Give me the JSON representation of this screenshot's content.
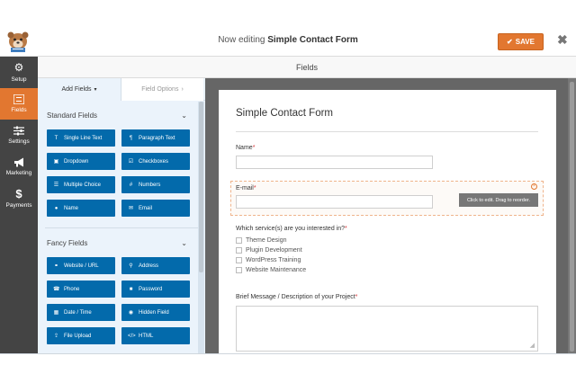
{
  "header": {
    "editing_prefix": "Now editing",
    "form_name": "Simple Contact Form",
    "save_label": "SAVE"
  },
  "leftnav": {
    "items": [
      {
        "label": "Setup",
        "icon": "gear-icon",
        "active": false
      },
      {
        "label": "Fields",
        "icon": "list-icon",
        "active": true
      },
      {
        "label": "Settings",
        "icon": "sliders-icon",
        "active": false
      },
      {
        "label": "Marketing",
        "icon": "megaphone-icon",
        "active": false
      },
      {
        "label": "Payments",
        "icon": "dollar-icon",
        "active": false
      }
    ]
  },
  "fields_header": "Fields",
  "panel": {
    "tab_add": "Add Fields",
    "tab_options": "Field Options",
    "standard_group": "Standard Fields",
    "fancy_group": "Fancy Fields",
    "standard_fields": [
      {
        "label": "Single Line Text",
        "icon": "text-icon"
      },
      {
        "label": "Paragraph Text",
        "icon": "paragraph-icon"
      },
      {
        "label": "Dropdown",
        "icon": "dropdown-icon"
      },
      {
        "label": "Checkboxes",
        "icon": "checkbox-icon"
      },
      {
        "label": "Multiple Choice",
        "icon": "list-icon"
      },
      {
        "label": "Numbers",
        "icon": "hash-icon"
      },
      {
        "label": "Name",
        "icon": "user-icon"
      },
      {
        "label": "Email",
        "icon": "envelope-icon"
      }
    ],
    "fancy_fields": [
      {
        "label": "Website / URL",
        "icon": "link-icon"
      },
      {
        "label": "Address",
        "icon": "map-pin-icon"
      },
      {
        "label": "Phone",
        "icon": "phone-icon"
      },
      {
        "label": "Password",
        "icon": "lock-icon"
      },
      {
        "label": "Date / Time",
        "icon": "calendar-icon"
      },
      {
        "label": "Hidden Field",
        "icon": "eye-slash-icon"
      },
      {
        "label": "File Upload",
        "icon": "upload-icon"
      },
      {
        "label": "HTML",
        "icon": "code-icon"
      }
    ]
  },
  "form": {
    "title": "Simple Contact Form",
    "name_label": "Name",
    "email_label": "E-mail",
    "tooltip": "Click to edit. Drag to reorder.",
    "services_label": "Which service(s) are you interested in?",
    "services": [
      "Theme Design",
      "Plugin Development",
      "WordPress Training",
      "Website Maintenance"
    ],
    "message_label": "Brief Message / Description of your Project",
    "required_mark": "*"
  },
  "colors": {
    "accent": "#e27730",
    "button_blue": "#036aab",
    "nav_bg": "#444444",
    "panel_bg": "#ebf3fb"
  }
}
